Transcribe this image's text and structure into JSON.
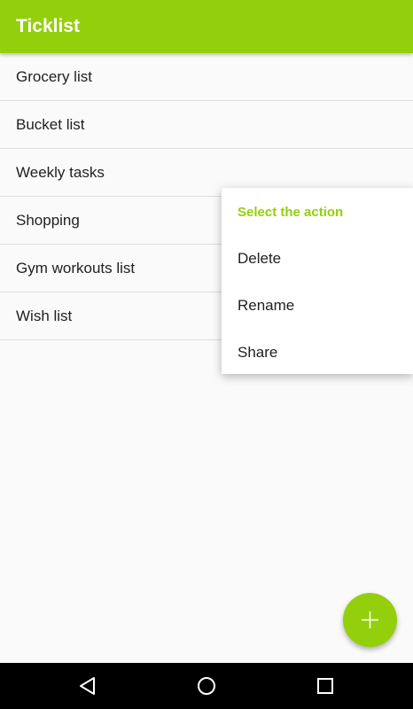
{
  "app": {
    "title": "Ticklist"
  },
  "lists": [
    {
      "label": "Grocery list"
    },
    {
      "label": "Bucket list"
    },
    {
      "label": "Weekly tasks"
    },
    {
      "label": "Shopping"
    },
    {
      "label": "Gym workouts list"
    },
    {
      "label": "Wish list"
    }
  ],
  "context_menu": {
    "title": "Select the action",
    "items": [
      {
        "label": "Delete"
      },
      {
        "label": "Rename"
      },
      {
        "label": "Share"
      }
    ]
  },
  "fab": {
    "icon": "plus-icon"
  },
  "navbar": {
    "icons": [
      "back-icon",
      "home-icon",
      "recents-icon"
    ]
  },
  "colors": {
    "accent": "#94cf0c",
    "background": "#fafafa",
    "text": "#212121"
  }
}
